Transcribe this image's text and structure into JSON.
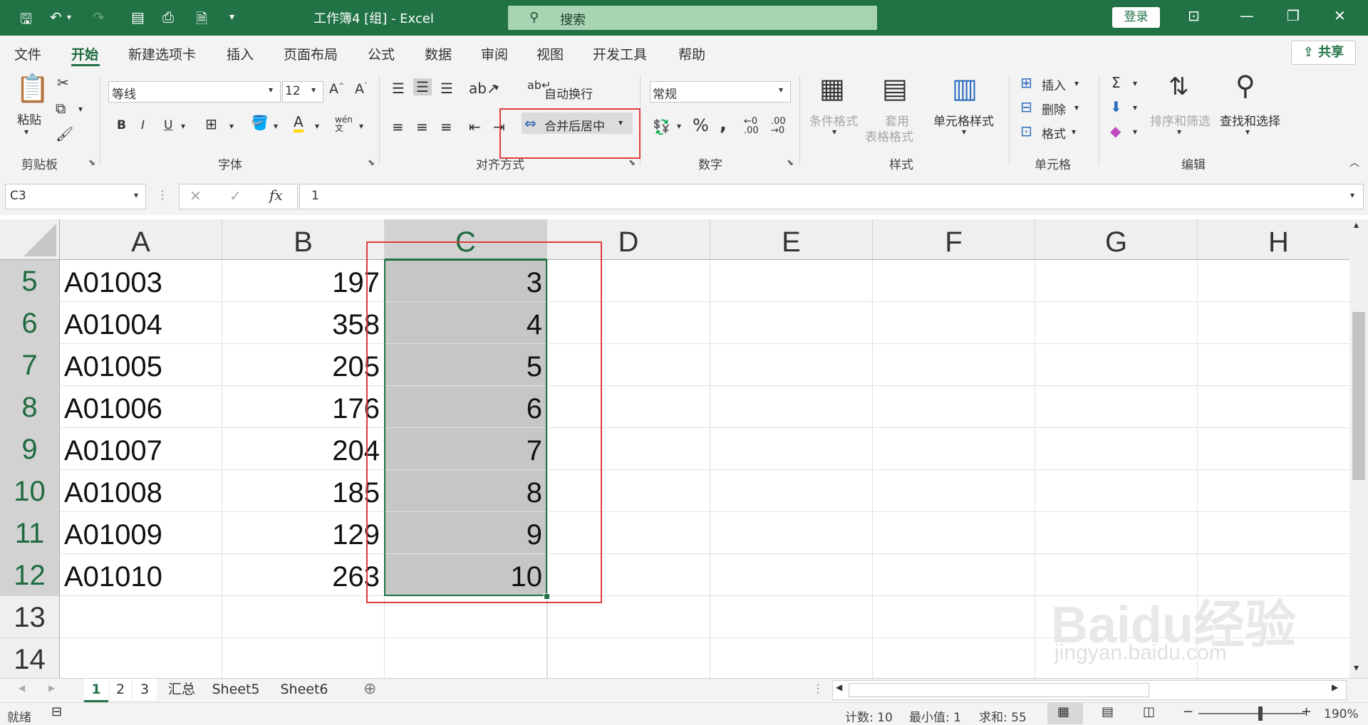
{
  "titlebar": {
    "title": "工作簿4 [组] - Excel",
    "search_label": "搜索",
    "login": "登录"
  },
  "menu": {
    "tabs": [
      "文件",
      "开始",
      "新建选项卡",
      "插入",
      "页面布局",
      "公式",
      "数据",
      "审阅",
      "视图",
      "开发工具",
      "帮助"
    ],
    "share": "共享"
  },
  "ribbon": {
    "paste": "粘贴",
    "clipboard_label": "剪贴板",
    "font_name": "等线",
    "font_size": "12",
    "font_label": "字体",
    "bold": "B",
    "italic": "I",
    "underline": "U",
    "wrap_text": "自动换行",
    "merge_center": "合并后居中",
    "align_label": "对齐方式",
    "number_format": "常规",
    "number_label": "数字",
    "cond_format": "条件格式",
    "table_format": "套用\n表格格式",
    "table_format_1": "套用",
    "table_format_2": "表格格式",
    "cell_style": "单元格样式",
    "style_label": "样式",
    "insert": "插入",
    "delete": "删除",
    "format": "格式",
    "cells_label": "单元格",
    "sort_filter": "排序和筛选",
    "find_select": "查找和选择",
    "edit_label": "编辑"
  },
  "formula_bar": {
    "name_box": "C3",
    "fx": "fx",
    "value": "1"
  },
  "grid": {
    "columns": [
      "A",
      "B",
      "C",
      "D",
      "E",
      "F",
      "G",
      "H"
    ],
    "rows": [
      {
        "num": "5",
        "a": "A01003",
        "b": "197",
        "c": "3"
      },
      {
        "num": "6",
        "a": "A01004",
        "b": "358",
        "c": "4"
      },
      {
        "num": "7",
        "a": "A01005",
        "b": "205",
        "c": "5"
      },
      {
        "num": "8",
        "a": "A01006",
        "b": "176",
        "c": "6"
      },
      {
        "num": "9",
        "a": "A01007",
        "b": "204",
        "c": "7"
      },
      {
        "num": "10",
        "a": "A01008",
        "b": "185",
        "c": "8"
      },
      {
        "num": "11",
        "a": "A01009",
        "b": "129",
        "c": "9"
      },
      {
        "num": "12",
        "a": "A01010",
        "b": "263",
        "c": "10"
      },
      {
        "num": "13",
        "a": "",
        "b": "",
        "c": ""
      },
      {
        "num": "14",
        "a": "",
        "b": "",
        "c": ""
      }
    ]
  },
  "sheets": [
    "1",
    "2",
    "3",
    "汇总",
    "Sheet5",
    "Sheet6"
  ],
  "status": {
    "ready": "就绪",
    "count": "计数: 10",
    "min": "最小值: 1",
    "sum": "求和: 55",
    "zoom": "190%"
  },
  "watermark": {
    "brand": "Baidu经验",
    "url": "jingyan.baidu.com"
  },
  "colors": {
    "excel_green": "#217346",
    "highlight_red": "#e03c3c"
  }
}
